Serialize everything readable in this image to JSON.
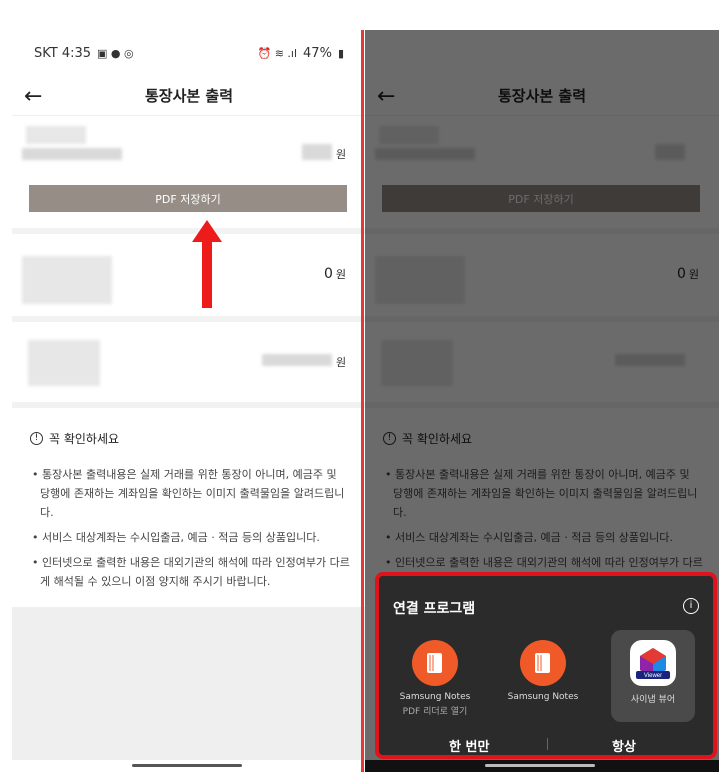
{
  "status": {
    "carrier_time": "SKT 4:35",
    "battery": "47%"
  },
  "appbar": {
    "back": "←",
    "title": "통장사본 출력"
  },
  "accounts": [
    {
      "amount_unit": "원",
      "pdf_button": "PDF 저장하기"
    },
    {
      "amount": "0",
      "amount_unit": "원"
    },
    {
      "amount_unit": "원"
    }
  ],
  "notice": {
    "title": "꼭 확인하세요",
    "items": [
      "• 통장사본 출력내용은 실제 거래를 위한 통장이 아니며, 예금주 및 당행에 존재하는 계좌임을 확인하는 이미지 출력물임을 알려드립니다.",
      "• 서비스 대상계좌는 수시입출금, 예금 · 적금 등의 상품입니다.",
      "• 인터넷으로 출력한 내용은 대외기관의 해석에 따라 인정여부가 다르게 해석될 수 있으니 이점 양지해 주시기 바랍니다."
    ]
  },
  "sheet": {
    "title": "연결 프로그램",
    "apps": [
      {
        "name": "Samsung Notes",
        "sub": "PDF 리더로 열기"
      },
      {
        "name": "Samsung Notes",
        "sub": ""
      },
      {
        "name": "사이냅 뷰어",
        "sub": "",
        "badge": "Viewer"
      }
    ],
    "once": "한 번만",
    "always": "항상"
  }
}
